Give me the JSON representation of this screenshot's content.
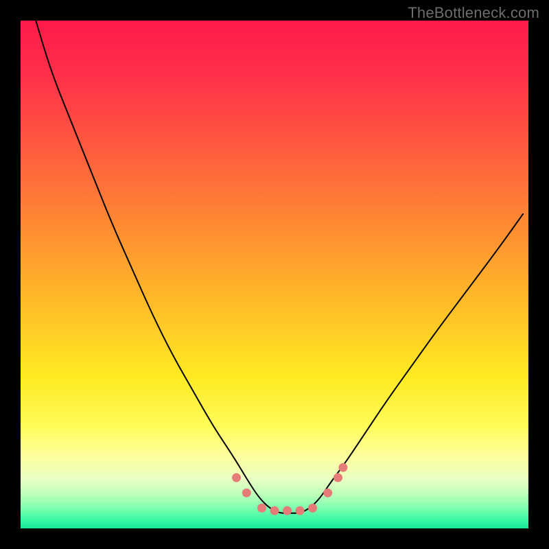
{
  "watermark": "TheBottleneck.com",
  "chart_data": {
    "type": "line",
    "title": "",
    "xlabel": "",
    "ylabel": "",
    "xlim": [
      0,
      100
    ],
    "ylim": [
      0,
      100
    ],
    "grid": false,
    "legend": false,
    "gradient_stops": [
      {
        "offset": 0.0,
        "color": "#ff1a4b"
      },
      {
        "offset": 0.1,
        "color": "#ff2e4a"
      },
      {
        "offset": 0.25,
        "color": "#ff5a3f"
      },
      {
        "offset": 0.4,
        "color": "#ff8a33"
      },
      {
        "offset": 0.55,
        "color": "#ffb928"
      },
      {
        "offset": 0.7,
        "color": "#ffea22"
      },
      {
        "offset": 0.8,
        "color": "#fffc5a"
      },
      {
        "offset": 0.86,
        "color": "#fdffa0"
      },
      {
        "offset": 0.905,
        "color": "#e8ffc4"
      },
      {
        "offset": 0.935,
        "color": "#b8ffb8"
      },
      {
        "offset": 0.96,
        "color": "#7dffb0"
      },
      {
        "offset": 0.985,
        "color": "#34f7a4"
      },
      {
        "offset": 1.0,
        "color": "#18e897"
      }
    ],
    "series": [
      {
        "name": "bottleneck-curve",
        "color": "#000000",
        "width": 2,
        "x": [
          3,
          6,
          10,
          14,
          18,
          22,
          26,
          30,
          34,
          38,
          42,
          45,
          47,
          49,
          51,
          53,
          55,
          57,
          59,
          61,
          64,
          68,
          72,
          77,
          82,
          88,
          94,
          99
        ],
        "values": [
          100,
          90,
          80,
          70,
          60,
          51,
          42,
          34,
          27,
          20,
          14,
          9,
          6,
          4,
          3,
          3,
          3,
          4,
          6,
          9,
          13,
          19,
          25,
          32,
          39,
          47,
          55,
          62
        ]
      }
    ],
    "markers": {
      "color": "#e57c78",
      "radius": 6.5,
      "points": [
        {
          "x": 42.5,
          "y": 10
        },
        {
          "x": 44.5,
          "y": 7
        },
        {
          "x": 47.5,
          "y": 4
        },
        {
          "x": 50.0,
          "y": 3.5
        },
        {
          "x": 52.5,
          "y": 3.5
        },
        {
          "x": 55.0,
          "y": 3.5
        },
        {
          "x": 57.5,
          "y": 4
        },
        {
          "x": 60.5,
          "y": 7
        },
        {
          "x": 62.5,
          "y": 10
        },
        {
          "x": 63.5,
          "y": 12
        }
      ]
    }
  }
}
